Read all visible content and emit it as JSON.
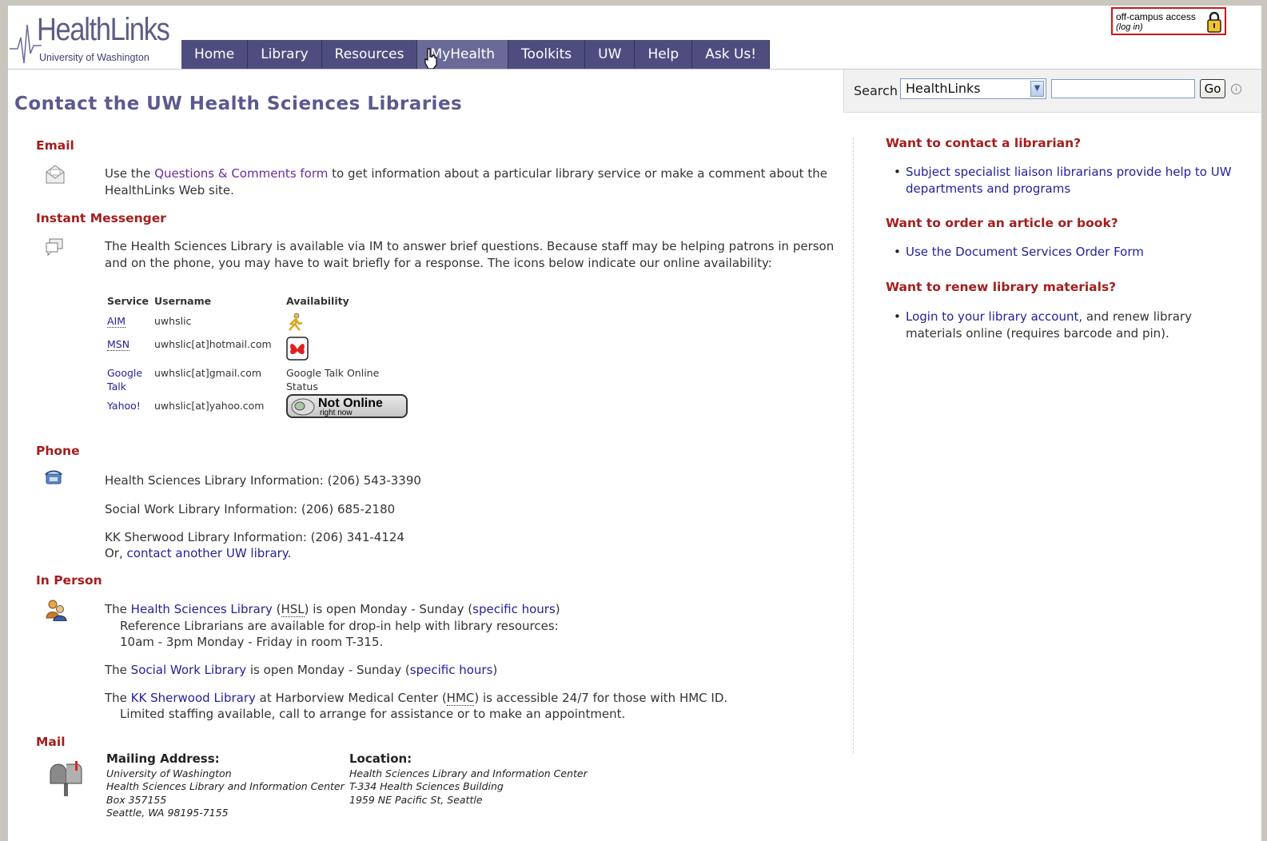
{
  "header": {
    "logo_name": "HealthLinks",
    "logo_sub": "University of Washington",
    "nav": [
      "Home",
      "Library",
      "Resources",
      "MyHealth",
      "Toolkits",
      "UW",
      "Help",
      "Ask Us!"
    ],
    "offcampus_line1": "off-campus access",
    "offcampus_line2": "(log in)"
  },
  "search": {
    "label": "Search",
    "scope": "HealthLinks",
    "query": "",
    "go": "Go",
    "info": "i"
  },
  "page_title": "Contact the UW Health Sciences Libraries",
  "email": {
    "heading": "Email",
    "pre": "Use the ",
    "link": "Questions & Comments form",
    "post": " to get information about a particular library service or make a comment about the HealthLinks Web site."
  },
  "im": {
    "heading": "Instant Messenger",
    "intro": "The Health Sciences Library is available via IM to answer brief questions. Because staff may be helping patrons in person and on the phone, you may have to wait briefly for a response. The icons below indicate our online availability:",
    "col_service": "Service",
    "col_username": "Username",
    "col_availability": "Availability",
    "rows": [
      {
        "service": "AIM",
        "username": "uwhslic",
        "availability": ""
      },
      {
        "service": "MSN",
        "username": "uwhslic[at]hotmail.com",
        "availability": ""
      },
      {
        "service": "Google Talk",
        "username": "uwhslic[at]gmail.com",
        "availability": "Google Talk Online Status"
      },
      {
        "service": "Yahoo!",
        "username": "uwhslic[at]yahoo.com",
        "availability": ""
      }
    ],
    "yahoo_status_big": "Not Online",
    "yahoo_status_small": "right now"
  },
  "phone": {
    "heading": "Phone",
    "hsl": "Health Sciences Library Information: (206) 543-3390",
    "sw": "Social Work Library Information: (206) 685-2180",
    "kk": "KK Sherwood Library Information: (206) 341-4124",
    "or_pre": "Or, ",
    "or_link": "contact another UW library",
    "or_post": "."
  },
  "inperson": {
    "heading": "In Person",
    "p1_pre": "The ",
    "p1_link": "Health Sciences Library",
    "p1_abbr": "HSL",
    "p1_mid": " is open Monday - Sunday (",
    "p1_hours": "specific hours",
    "p1_end": ")",
    "p1_l2": "Reference Librarians are available for drop-in help with library resources:",
    "p1_l3": "10am - 3pm Monday - Friday in room T-315.",
    "p2_pre": "The ",
    "p2_link": "Social Work Library",
    "p2_mid": " is open Monday - Sunday (",
    "p2_hours": "specific hours",
    "p2_end": ")",
    "p3_pre": "The ",
    "p3_link": "KK Sherwood Library",
    "p3_mid": " at Harborview Medical Center (",
    "p3_abbr": "HMC",
    "p3_end": ") is accessible 24/7 for those with HMC ID.",
    "p3_l2": "Limited staffing available, call to arrange for assistance or to make an appointment."
  },
  "mail": {
    "heading": "Mail",
    "mailing_heading": "Mailing Address:",
    "mailing_lines": [
      "University of Washington",
      "Health Sciences Library and Information Center",
      "Box 357155",
      "Seattle, WA 98195-7155"
    ],
    "location_heading": "Location:",
    "location_lines": [
      "Health Sciences Library and Information Center",
      "T-334 Health Sciences Building",
      "1959 NE Pacific St, Seattle"
    ]
  },
  "sidebar": {
    "q1": "Want to contact a librarian?",
    "q1_link": "Subject specialist liaison librarians provide help to UW departments and programs",
    "q2": "Want to order an article or book?",
    "q2_link": "Use the Document Services Order Form",
    "q3": "Want to renew library materials?",
    "q3_link": "Login to your library account",
    "q3_post": ", and renew library materials online (requires barcode and pin)."
  },
  "colors": {
    "nav_bg": "#4d4d80",
    "title": "#5a5a8e",
    "heading_red": "#a51d1d",
    "link": "#22229a"
  }
}
